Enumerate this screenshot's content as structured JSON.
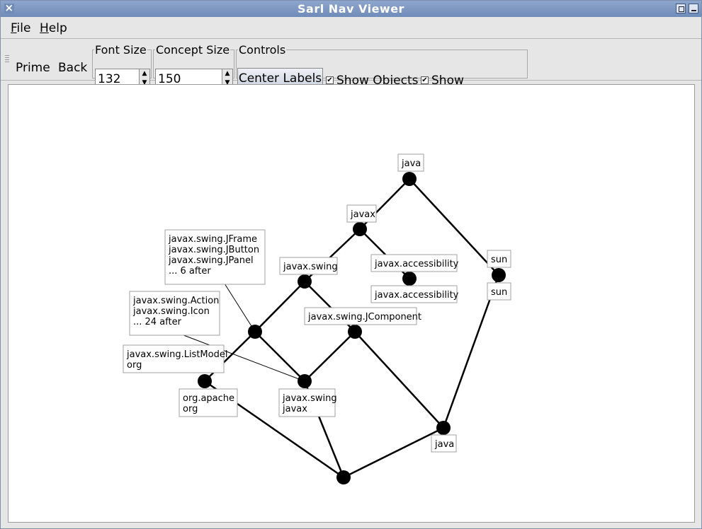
{
  "window": {
    "title": "Sarl Nav Viewer",
    "close_glyph": "×"
  },
  "menu": {
    "file_rest": "ile",
    "file_mnemonic": "F",
    "help_rest": "elp",
    "help_mnemonic": "H"
  },
  "toolbar": {
    "prime_label": "Prime",
    "back_label": "Back",
    "font_size_legend": "Font Size",
    "font_size_value": "132",
    "concept_size_legend": "Concept Size",
    "concept_size_value": "150",
    "controls_legend": "Controls",
    "center_labels_label": "Center Labels",
    "show_objects_label": "Show Objects",
    "show_objects_checked": true,
    "show_attributes_label": "Show Attributes",
    "show_attributes_checked": true
  },
  "lattice": {
    "nodes": [
      {
        "id": "n-java-top"
      },
      {
        "id": "n-javax"
      },
      {
        "id": "n-sun"
      },
      {
        "id": "n-javax-swing"
      },
      {
        "id": "n-javax-accessibility"
      },
      {
        "id": "n-jframe"
      },
      {
        "id": "n-jcomponent"
      },
      {
        "id": "n-org-apache"
      },
      {
        "id": "n-swing-mid"
      },
      {
        "id": "n-java-bottom"
      },
      {
        "id": "n-bottom"
      }
    ],
    "labels": [
      {
        "id": "lbl-java-top",
        "lines": [
          "java"
        ]
      },
      {
        "id": "lbl-javax",
        "lines": [
          "javax"
        ]
      },
      {
        "id": "lbl-sun-top",
        "lines": [
          "sun"
        ]
      },
      {
        "id": "lbl-sun-bottom",
        "lines": [
          "sun"
        ]
      },
      {
        "id": "lbl-javax-swing",
        "lines": [
          "javax.swing"
        ]
      },
      {
        "id": "lbl-accessibility-top",
        "lines": [
          "javax.accessibility"
        ]
      },
      {
        "id": "lbl-accessibility-bottom",
        "lines": [
          "javax.accessibility"
        ]
      },
      {
        "id": "lbl-jframe-objects",
        "lines": [
          "javax.swing.JFrame",
          "javax.swing.JButton",
          "javax.swing.JPanel",
          "... 6 after"
        ]
      },
      {
        "id": "lbl-action-objects",
        "lines": [
          "javax.swing.Action",
          "javax.swing.Icon",
          "... 24 after"
        ]
      },
      {
        "id": "lbl-jcomponent",
        "lines": [
          "javax.swing.JComponent"
        ]
      },
      {
        "id": "lbl-listmodel",
        "lines": [
          "javax.swing.ListModel",
          "org"
        ]
      },
      {
        "id": "lbl-org-apache",
        "lines": [
          "org.apache",
          "org"
        ]
      },
      {
        "id": "lbl-swing-javax",
        "lines": [
          "javax.swing",
          "javax"
        ]
      },
      {
        "id": "lbl-java-bottom",
        "lines": [
          "java"
        ]
      }
    ]
  }
}
